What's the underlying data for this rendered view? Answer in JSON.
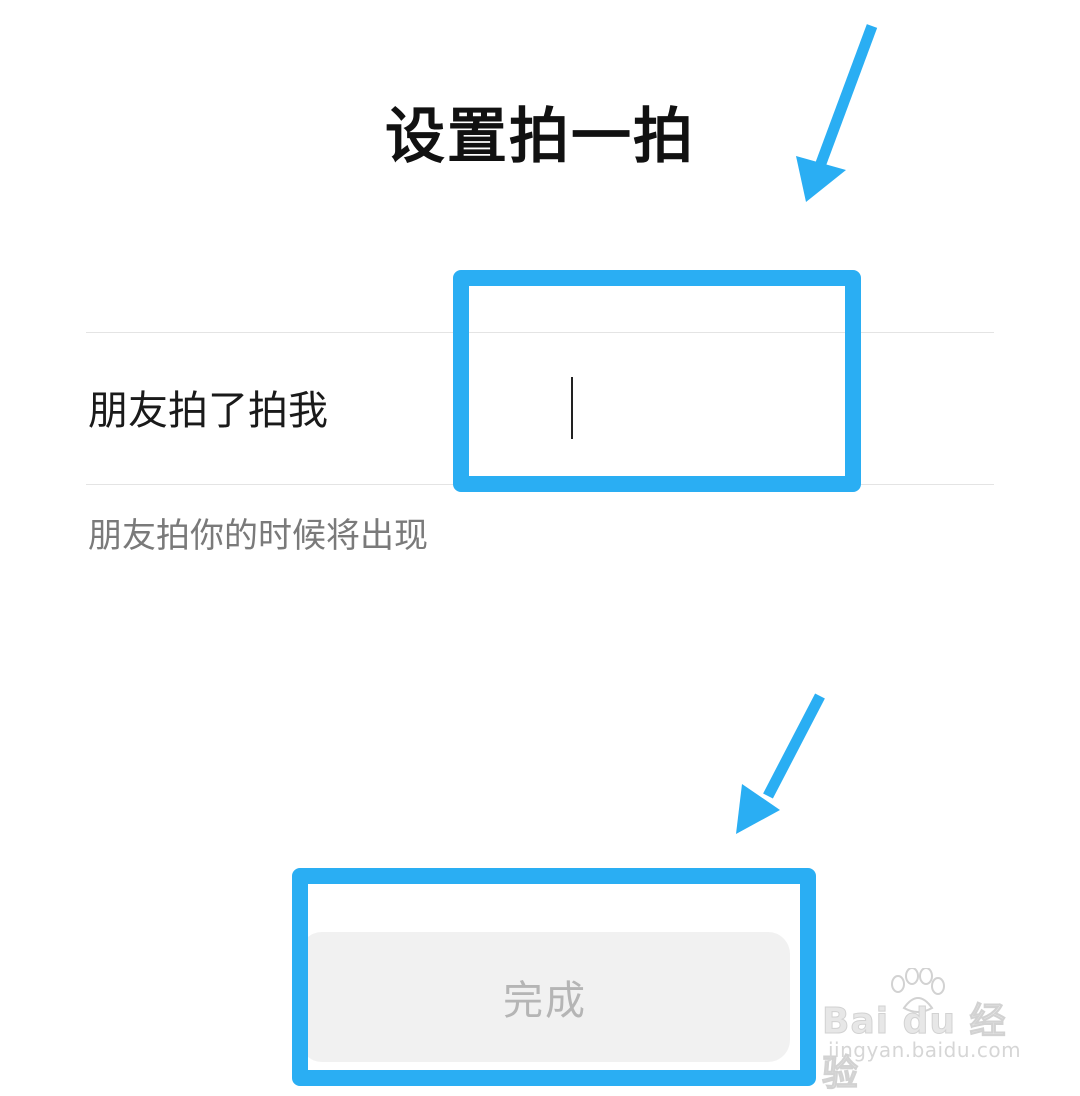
{
  "page": {
    "title": "设置拍一拍"
  },
  "pat_setting": {
    "label": "朋友拍了拍我",
    "suffix_value": "",
    "hint": "朋友拍你的时候将出现"
  },
  "actions": {
    "done_label": "完成"
  },
  "annotations": {
    "highlight_color": "#2aaef3",
    "arrow_color": "#2aaef3"
  },
  "watermark": {
    "brand": "Bai du 经验",
    "url": "jingyan.baidu.com"
  },
  "colors": {
    "background": "#ffffff",
    "button_bg": "#f1f1f1",
    "button_text_disabled": "#b5b5b5",
    "hint_text": "#7a7a7a",
    "divider": "#e4e4e4"
  }
}
